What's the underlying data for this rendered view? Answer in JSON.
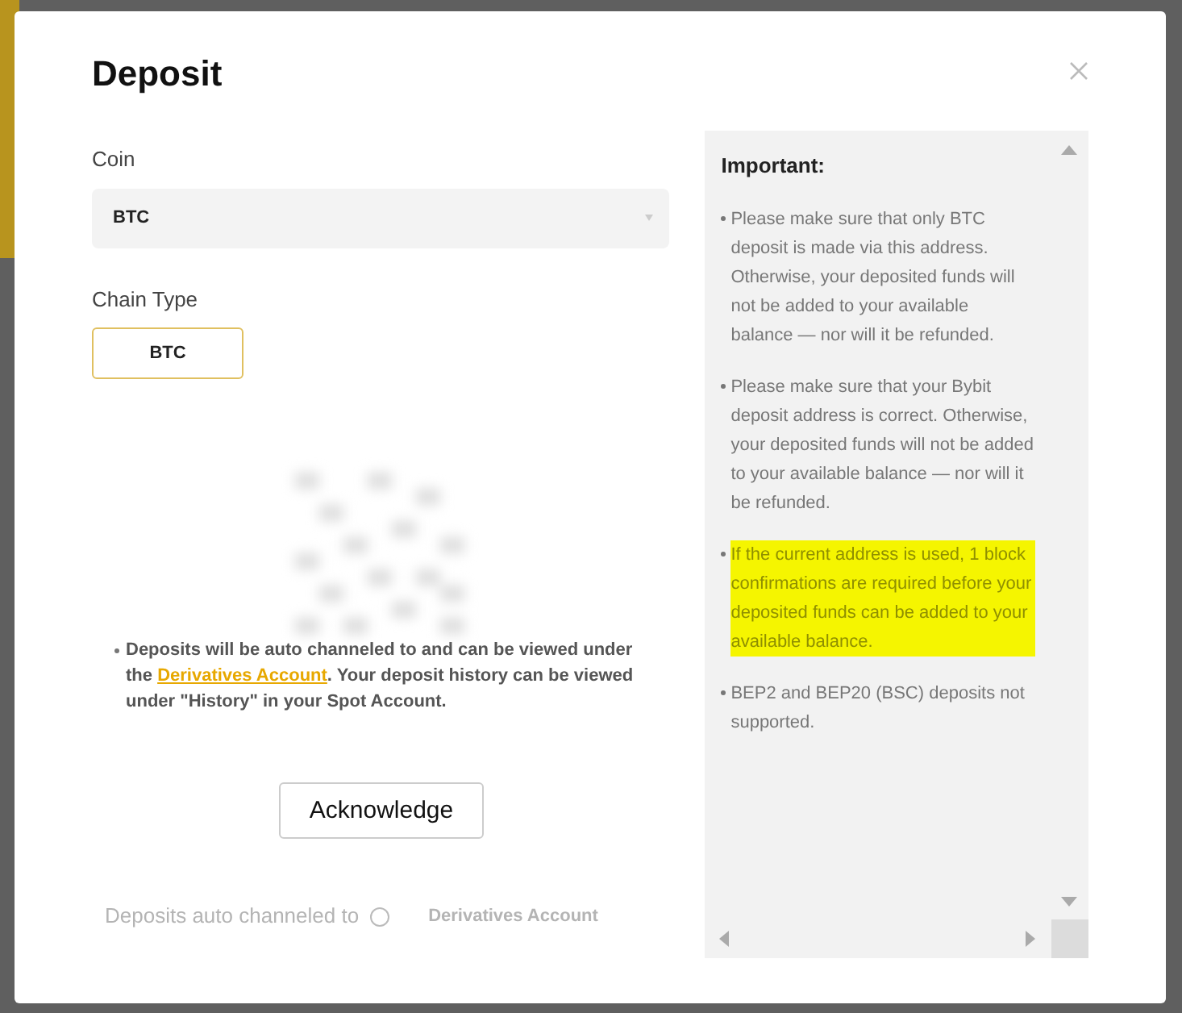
{
  "dialog": {
    "title": "Deposit",
    "coin": {
      "label": "Coin",
      "value": "BTC"
    },
    "chain_type": {
      "label": "Chain Type",
      "options": [
        {
          "label": "BTC",
          "selected": true
        }
      ]
    },
    "notice": {
      "before": "Deposits will be auto channeled to and can be viewed under the ",
      "link": "Derivatives Account",
      "after": ". Your deposit history can be viewed under \"History\" in your Spot Account."
    },
    "button": "Acknowledge",
    "faded_row": {
      "label": "Deposits auto channeled to",
      "value": "Derivatives Account"
    },
    "important": {
      "title": "Important:",
      "items": [
        {
          "text": "Please make sure that only BTC deposit is made via this address. Otherwise, your deposited funds will not be added to your available balance — nor will it be refunded.",
          "highlighted": false
        },
        {
          "text": "Please make sure that your Bybit deposit address is correct. Otherwise, your deposited funds will not be added to your available balance — nor will it be refunded.",
          "highlighted": false
        },
        {
          "text": "If the current address is used, 1 block confirmations are required before your deposited funds can be added to your available balance.",
          "highlighted": true
        },
        {
          "text": "BEP2 and BEP20 (BSC) deposits not supported.",
          "highlighted": false
        }
      ]
    }
  }
}
